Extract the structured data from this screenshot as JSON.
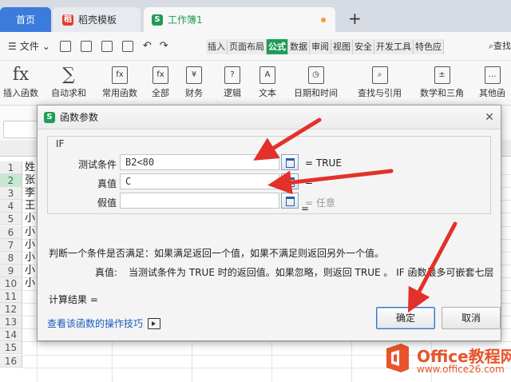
{
  "tabs": {
    "home": "首页",
    "templates": "稻壳模板",
    "workbook": "工作簿1"
  },
  "menu": {
    "file": "文件",
    "ribbon_tabs": [
      "插入",
      "页面布局",
      "公式",
      "数据",
      "审阅",
      "视图",
      "安全",
      "开发工具",
      "特色应"
    ],
    "active_tab": "公式",
    "search": "查找"
  },
  "functions": [
    {
      "label": "插入函数",
      "glyph": "fx"
    },
    {
      "label": "自动求和",
      "glyph": "∑"
    },
    {
      "label": "常用函数",
      "glyph": "fx"
    },
    {
      "label": "全部",
      "glyph": "fx"
    },
    {
      "label": "财务",
      "glyph": "¥"
    },
    {
      "label": "逻辑",
      "glyph": "?"
    },
    {
      "label": "文本",
      "glyph": "A"
    },
    {
      "label": "日期和时间",
      "glyph": "◷"
    },
    {
      "label": "查找与引用",
      "glyph": "⌕"
    },
    {
      "label": "数学和三角",
      "glyph": "±"
    },
    {
      "label": "其他函",
      "glyph": "…"
    }
  ],
  "sheet": {
    "rows": [
      "1",
      "2",
      "3",
      "4",
      "5",
      "6",
      "7",
      "8",
      "9",
      "10",
      "11",
      "12",
      "13",
      "14",
      "15",
      "16"
    ],
    "selected_row": "2",
    "col_a": [
      "姓",
      "张",
      "李",
      "王",
      "小",
      "小",
      "小",
      "小",
      "小",
      "小"
    ]
  },
  "dialog": {
    "title": "函数参数",
    "function_name": "IF",
    "args": [
      {
        "label": "测试条件",
        "value": "B2<80",
        "result": "= TRUE"
      },
      {
        "label": "真值",
        "value": "C",
        "result": "="
      },
      {
        "label": "假值",
        "value": "",
        "result": "= 任意"
      }
    ],
    "middle_equals": "=",
    "description": "判断一个条件是否满足：如果满足返回一个值，如果不满足则返回另外一个值。",
    "param_name": "真值:",
    "param_description": "当测试条件为 TRUE 时的返回值。如果忽略，则返回 TRUE 。 IF 函数最多可嵌套七层",
    "calc_result": "计算结果 =",
    "help_link": "查看该函数的操作技巧",
    "ok": "确定",
    "cancel": "取消"
  },
  "watermark": {
    "title": "Office教程网",
    "url": "www.office26.com"
  },
  "colors": {
    "accent_green": "#1f9d55",
    "home_tab_blue": "#3a7bdc",
    "arrow_red": "#e3312a",
    "watermark_orange": "#e8542b"
  }
}
